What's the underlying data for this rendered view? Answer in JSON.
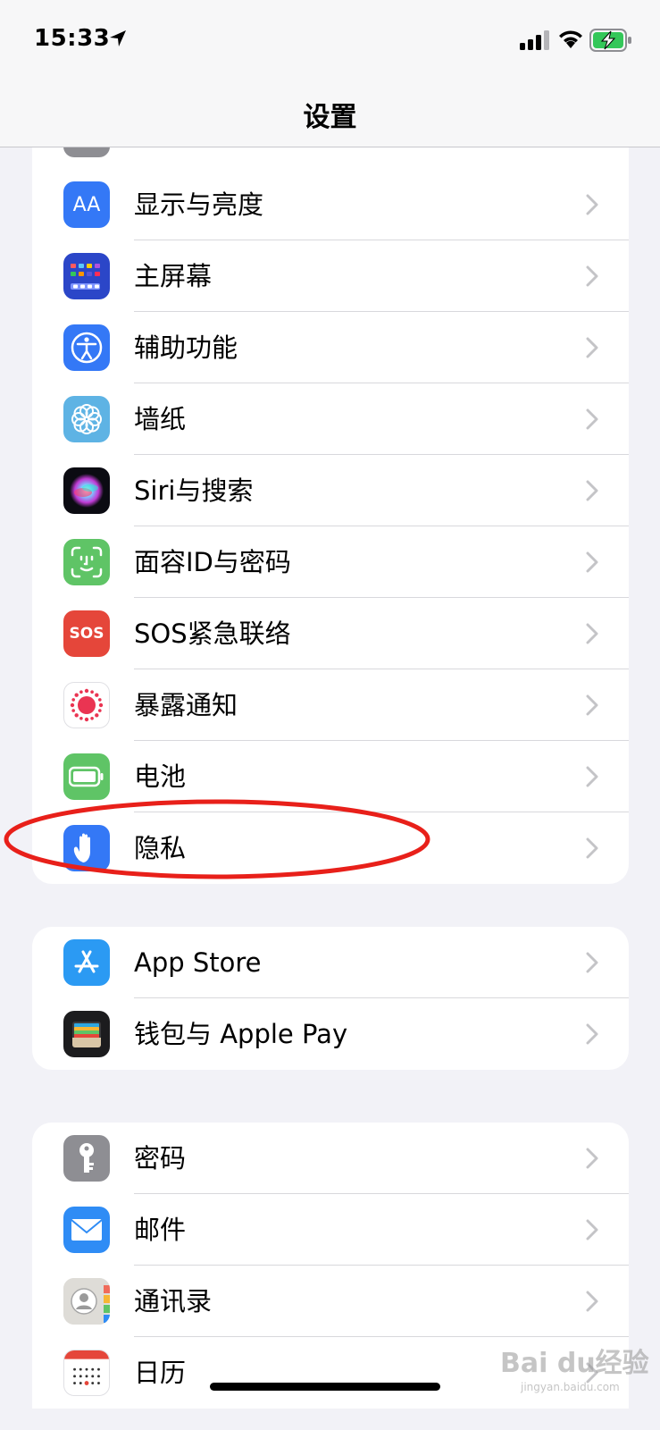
{
  "status": {
    "time": "15:33"
  },
  "nav": {
    "title": "设置"
  },
  "group1": [
    {
      "label": "显示与亮度"
    },
    {
      "label": "主屏幕"
    },
    {
      "label": "辅助功能"
    },
    {
      "label": "墙纸"
    },
    {
      "label": "Siri与搜索"
    },
    {
      "label": "面容ID与密码"
    },
    {
      "label": "SOS紧急联络"
    },
    {
      "label": "暴露通知"
    },
    {
      "label": "电池"
    },
    {
      "label": "隐私"
    }
  ],
  "group2": [
    {
      "label": "App Store"
    },
    {
      "label": "钱包与 Apple Pay"
    }
  ],
  "group3": [
    {
      "label": "密码"
    },
    {
      "label": "邮件"
    },
    {
      "label": "通讯录"
    },
    {
      "label": "日历"
    }
  ],
  "icons": {
    "aa_text": "AA",
    "sos_text": "SOS"
  },
  "colors": {
    "annotation": "#e8201a",
    "accent": "#3478f6"
  },
  "watermark": {
    "text": "Bai du经验",
    "sub": "jingyan.baidu.com"
  }
}
